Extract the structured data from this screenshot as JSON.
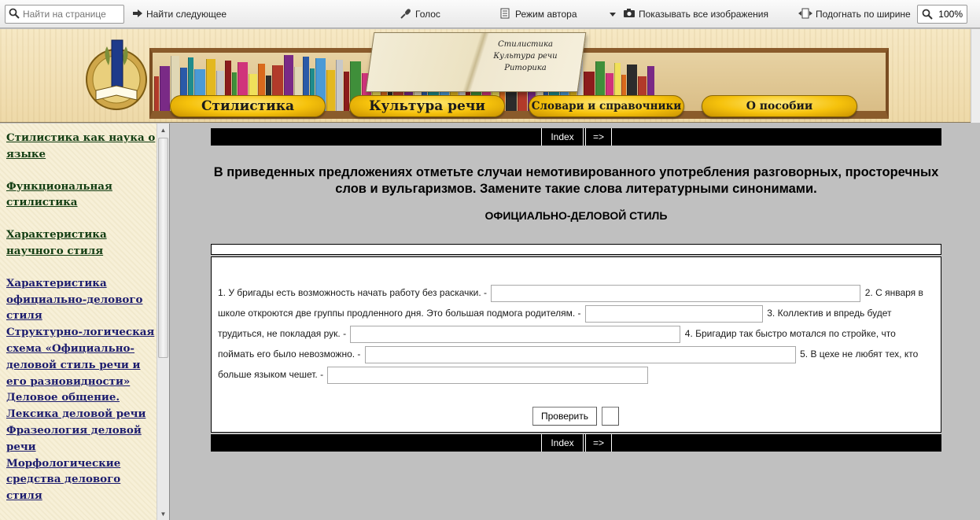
{
  "toolbar": {
    "search_placeholder": "Найти на странице",
    "find_next": "Найти следующее",
    "voice": "Голос",
    "author_mode": "Режим автора",
    "show_images": "Показывать все изображения",
    "fit_width": "Подогнать по ширине",
    "zoom": "100%"
  },
  "banner": {
    "book_lines": [
      "Стилистика",
      "Культура речи",
      "Риторика"
    ],
    "nav": [
      "Стилистика",
      "Культура речи",
      "Словари и справочники",
      "О пособии"
    ]
  },
  "sidebar": {
    "items": [
      {
        "label": "Стилистика как наука о языке"
      },
      {
        "label": "Функциональная стилистика"
      },
      {
        "label": "Характеристика научного стиля"
      },
      {
        "label": "Характеристика официально-делового стиля"
      },
      {
        "label": "Структурно-логическая схема «Официально-деловой стиль речи и его разновидности»"
      },
      {
        "label": "Деловое общение."
      },
      {
        "label": "Лексика деловой речи"
      },
      {
        "label": "Фразеология деловой речи"
      },
      {
        "label": "Морфологические средства делового стиля"
      }
    ]
  },
  "navbar": {
    "index": "Index",
    "next": "=>"
  },
  "content": {
    "heading": "В приведенных предложениях отметьте случаи немотивированного употребления разговорных, просторечных слов и вульгаризмов. Замените такие слова литературными синонимами.",
    "subheading": "ОФИЦИАЛЬНО-ДЕЛОВОЙ СТИЛЬ",
    "sentences": [
      "1. У бригады есть возможность начать работу без раскачки. -",
      "2. С января в школе откроются две группы продленного дня. Это большая подмога родителям. -",
      "3. Коллектив и впредь будет трудиться, не покладая рук. -",
      "4. Бригадир так быстро мотался по стройке, что поймать его было невозможно. -",
      "5. В цехе не любят тех, кто больше языком чешет. -"
    ],
    "check_button": "Проверить"
  }
}
